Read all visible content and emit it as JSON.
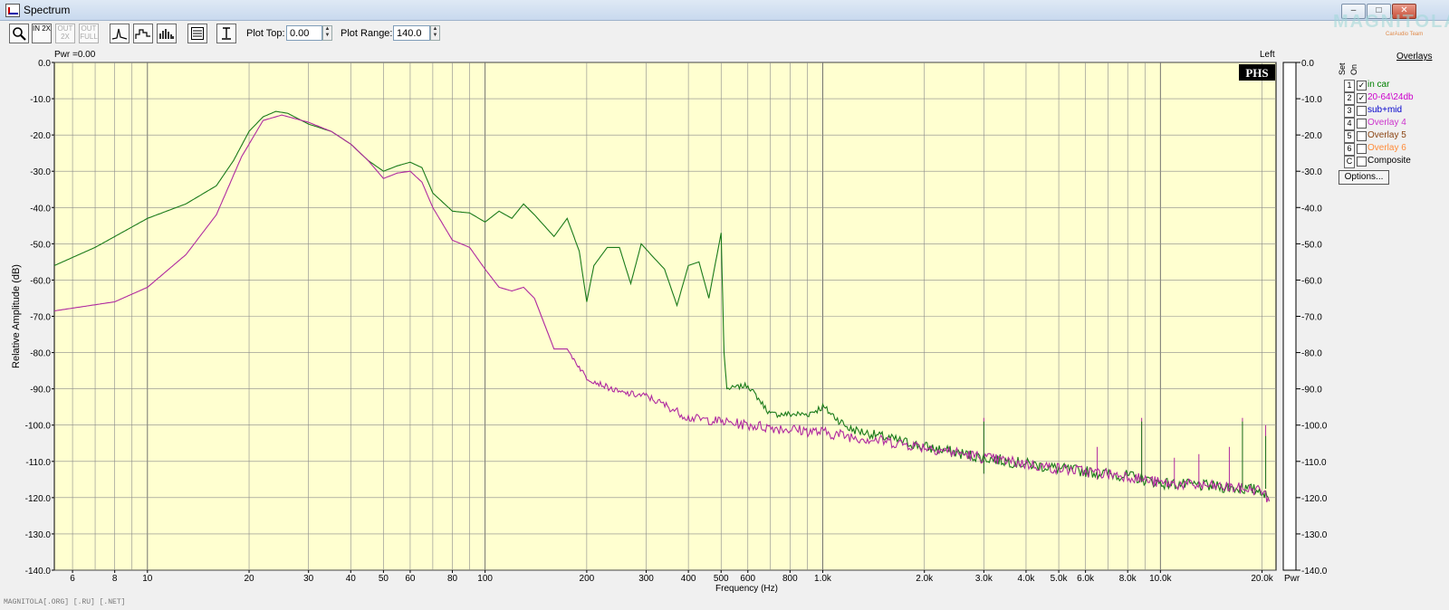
{
  "window": {
    "title": "Spectrum",
    "minimize": "–",
    "maximize": "□",
    "close": "✕"
  },
  "watermark": {
    "brand": "MAGNITOLA",
    "team": "CarAudio Team"
  },
  "toolbar": {
    "zoom_icon": "magnifier-icon",
    "in_2x": "IN 2X",
    "out_2x": "OUT 2X",
    "out_full": "OUT FULL",
    "plot_top_label": "Plot Top:",
    "plot_top_value": "0.00",
    "plot_range_label": "Plot Range:",
    "plot_range_value": "140.0"
  },
  "plot": {
    "pwr_readout": "Pwr =0.00",
    "channel": "Left",
    "badge": "PHS",
    "pwr_axis_label": "Pwr"
  },
  "overlays": {
    "title": "Overlays",
    "set_header": "Set",
    "on_header": "On",
    "items": [
      {
        "num": "1",
        "checked": true,
        "name": "in car",
        "color": "#008000"
      },
      {
        "num": "2",
        "checked": true,
        "name": "20-64\\24db",
        "color": "#cc00cc"
      },
      {
        "num": "3",
        "checked": false,
        "name": "sub+mid",
        "color": "#0000cc"
      },
      {
        "num": "4",
        "checked": false,
        "name": "Overlay 4",
        "color": "#cc33cc"
      },
      {
        "num": "5",
        "checked": false,
        "name": "Overlay 5",
        "color": "#8b4513"
      },
      {
        "num": "6",
        "checked": false,
        "name": "Overlay 6",
        "color": "#ff8c3a"
      },
      {
        "num": "C",
        "checked": false,
        "name": "Composite",
        "color": "#000000"
      }
    ],
    "options_label": "Options..."
  },
  "status": "MAGNITOLA[.ORG] [.RU] [.NET]",
  "chart_data": {
    "type": "line",
    "title": "",
    "xlabel": "Frequency (Hz)",
    "ylabel": "Relative Amplitude (dB)",
    "xscale": "log",
    "xlim": [
      5.3,
      22000
    ],
    "ylim": [
      -140,
      0
    ],
    "grid": true,
    "background": "#ffffd0",
    "x_ticks": [
      {
        "v": 6,
        "label": "6"
      },
      {
        "v": 8,
        "label": "8"
      },
      {
        "v": 10,
        "label": "10"
      },
      {
        "v": 20,
        "label": "20"
      },
      {
        "v": 30,
        "label": "30"
      },
      {
        "v": 40,
        "label": "40"
      },
      {
        "v": 50,
        "label": "50"
      },
      {
        "v": 60,
        "label": "60"
      },
      {
        "v": 80,
        "label": "80"
      },
      {
        "v": 100,
        "label": "100"
      },
      {
        "v": 200,
        "label": "200"
      },
      {
        "v": 300,
        "label": "300"
      },
      {
        "v": 400,
        "label": "400"
      },
      {
        "v": 500,
        "label": "500"
      },
      {
        "v": 600,
        "label": "600"
      },
      {
        "v": 800,
        "label": "800"
      },
      {
        "v": 1000,
        "label": "1.0k"
      },
      {
        "v": 2000,
        "label": "2.0k"
      },
      {
        "v": 3000,
        "label": "3.0k"
      },
      {
        "v": 4000,
        "label": "4.0k"
      },
      {
        "v": 5000,
        "label": "5.0k"
      },
      {
        "v": 6000,
        "label": "6.0k"
      },
      {
        "v": 8000,
        "label": "8.0k"
      },
      {
        "v": 10000,
        "label": "10.0k"
      },
      {
        "v": 20000,
        "label": "20.0k"
      }
    ],
    "y_ticks_left": [
      "0.0",
      "-10.0",
      "-20.0",
      "-30.0",
      "-40.0",
      "-50.0",
      "-60.0",
      "-70.0",
      "-80.0",
      "-90.0",
      "-100.0",
      "-110.0",
      "-120.0",
      "-130.0",
      "-140.0"
    ],
    "y_ticks_right": [
      "0.0",
      "-10.0",
      "-20.0",
      "-30.0",
      "-40.0",
      "-50.0",
      "-60.0",
      "-70.0",
      "-80.0",
      "-90.0",
      "-100.0",
      "-110.0",
      "-120.0",
      "-130.0",
      "-140.0"
    ],
    "series": [
      {
        "name": "in car",
        "color": "#1a7a1a",
        "points": [
          [
            5.3,
            -56
          ],
          [
            7,
            -51
          ],
          [
            10,
            -43
          ],
          [
            13,
            -39
          ],
          [
            16,
            -34
          ],
          [
            18,
            -27
          ],
          [
            20,
            -19
          ],
          [
            22,
            -15
          ],
          [
            24,
            -13.5
          ],
          [
            26,
            -14
          ],
          [
            30,
            -17
          ],
          [
            35,
            -19
          ],
          [
            40,
            -22.5
          ],
          [
            45,
            -27
          ],
          [
            50,
            -30
          ],
          [
            55,
            -28.5
          ],
          [
            60,
            -27.5
          ],
          [
            65,
            -29
          ],
          [
            70,
            -36
          ],
          [
            80,
            -41
          ],
          [
            90,
            -41.5
          ],
          [
            100,
            -44
          ],
          [
            110,
            -41
          ],
          [
            120,
            -43
          ],
          [
            130,
            -39
          ],
          [
            140,
            -42
          ],
          [
            160,
            -48
          ],
          [
            175,
            -43
          ],
          [
            190,
            -52
          ],
          [
            200,
            -66
          ],
          [
            210,
            -56
          ],
          [
            230,
            -51
          ],
          [
            250,
            -51
          ],
          [
            270,
            -61
          ],
          [
            290,
            -50
          ],
          [
            310,
            -53
          ],
          [
            340,
            -57
          ],
          [
            370,
            -67
          ],
          [
            400,
            -56
          ],
          [
            430,
            -55
          ],
          [
            460,
            -65
          ],
          [
            500,
            -47
          ],
          [
            510,
            -80
          ],
          [
            520,
            -90
          ],
          [
            600,
            -89
          ],
          [
            700,
            -97
          ],
          [
            900,
            -97
          ],
          [
            1000,
            -95
          ],
          [
            1200,
            -101
          ],
          [
            2000,
            -106
          ],
          [
            3000,
            -109
          ],
          [
            5000,
            -112
          ],
          [
            8000,
            -114
          ],
          [
            10000,
            -116
          ],
          [
            15000,
            -117
          ],
          [
            20000,
            -118
          ],
          [
            21000,
            -121
          ]
        ]
      },
      {
        "name": "20-64\\24db",
        "color": "#b02aa0",
        "points": [
          [
            5.3,
            -68.5
          ],
          [
            8,
            -66
          ],
          [
            10,
            -62
          ],
          [
            13,
            -53
          ],
          [
            16,
            -42
          ],
          [
            19,
            -26
          ],
          [
            22,
            -16
          ],
          [
            25,
            -14.5
          ],
          [
            30,
            -16.5
          ],
          [
            35,
            -19
          ],
          [
            40,
            -22.5
          ],
          [
            45,
            -27
          ],
          [
            50,
            -32
          ],
          [
            55,
            -30.5
          ],
          [
            60,
            -30
          ],
          [
            65,
            -33
          ],
          [
            70,
            -40
          ],
          [
            80,
            -49
          ],
          [
            90,
            -51
          ],
          [
            100,
            -57
          ],
          [
            110,
            -62
          ],
          [
            120,
            -63
          ],
          [
            130,
            -62
          ],
          [
            140,
            -65
          ],
          [
            160,
            -79
          ],
          [
            175,
            -79
          ],
          [
            190,
            -84
          ],
          [
            200,
            -87
          ],
          [
            250,
            -91
          ],
          [
            300,
            -92
          ],
          [
            350,
            -95
          ],
          [
            400,
            -98
          ],
          [
            500,
            -99
          ],
          [
            600,
            -100
          ],
          [
            1000,
            -102
          ],
          [
            2000,
            -106
          ],
          [
            3000,
            -109
          ],
          [
            5000,
            -112
          ],
          [
            8000,
            -114
          ],
          [
            10000,
            -116
          ],
          [
            15000,
            -117
          ],
          [
            20000,
            -118
          ],
          [
            21000,
            -121
          ]
        ]
      }
    ],
    "peaks_20_64": [
      [
        3000,
        -98
      ],
      [
        6500,
        -106
      ],
      [
        8800,
        -98
      ],
      [
        11000,
        -109
      ],
      [
        13000,
        -108
      ],
      [
        16000,
        -106
      ],
      [
        17500,
        -98
      ],
      [
        20500,
        -100
      ]
    ],
    "peaks_in_car": [
      [
        3000,
        -99
      ],
      [
        8800,
        -99
      ],
      [
        17500,
        -99
      ],
      [
        20500,
        -103
      ]
    ]
  }
}
